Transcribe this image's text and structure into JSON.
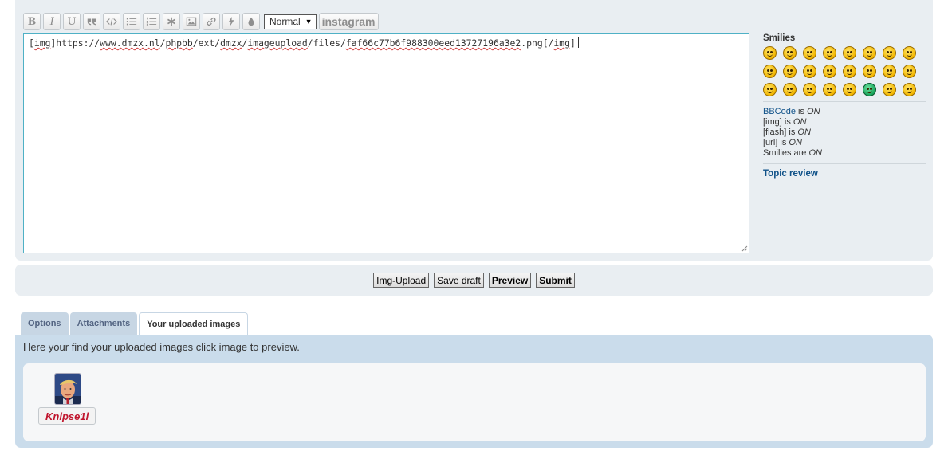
{
  "toolbar": {
    "bold": "B",
    "italic": "I",
    "underline": "U",
    "font_size": "Normal",
    "instagram": "instagram"
  },
  "editor": {
    "text_prefix": "[",
    "text_img_open": "img",
    "text_after_open": "]https://",
    "text_w1": "www.dmzx.nl",
    "text_s1": "/",
    "text_w2": "phpbb",
    "text_s2": "/ext/",
    "text_w3": "dmzx",
    "text_s3": "/",
    "text_w4": "imageupload",
    "text_s4": "/files/",
    "text_w5": "faf66c77b6f988300eed13727196a3e2",
    "text_s5": ".png[/",
    "text_img_close": "img",
    "text_end": "]"
  },
  "sidebar": {
    "smilies_title": "Smilies",
    "bbcode_link": "BBCode",
    "bbcode_is": " is ",
    "bbcode_state": "ON",
    "img_label": "[img] is ",
    "img_state": "ON",
    "flash_label": "[flash] is ",
    "flash_state": "ON",
    "url_label": "[url] is ",
    "url_state": "ON",
    "smilies_label": "Smilies are ",
    "smilies_state": "ON",
    "topic_review": "Topic review"
  },
  "submit_bar": {
    "img_upload": "Img-Upload",
    "save_draft": "Save draft",
    "preview": "Preview",
    "submit": "Submit"
  },
  "tabs": [
    {
      "label": "Options"
    },
    {
      "label": "Attachments"
    },
    {
      "label": "Your uploaded images"
    }
  ],
  "panel": {
    "intro": "Here your find your uploaded images click image to preview.",
    "image_name": "Knipse1l"
  }
}
